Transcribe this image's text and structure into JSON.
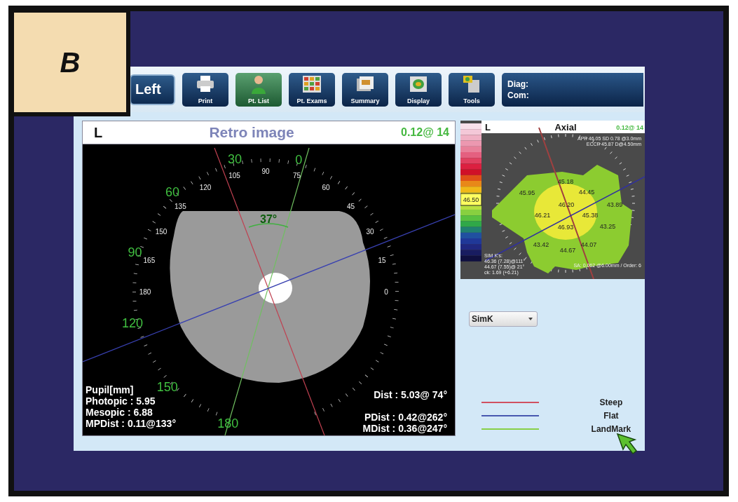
{
  "figure_label": "B",
  "toolbar": {
    "side_button": "Left",
    "buttons": [
      {
        "label": "Print",
        "kind": "print",
        "selected": false
      },
      {
        "label": "Pt. List",
        "kind": "patient",
        "selected": true
      },
      {
        "label": "Pt. Exams",
        "kind": "exams",
        "selected": false
      },
      {
        "label": "Summary",
        "kind": "summary",
        "selected": false
      },
      {
        "label": "Display",
        "kind": "display",
        "selected": false
      },
      {
        "label": "Tools",
        "kind": "tools",
        "selected": false
      }
    ],
    "diag_label": "Diag:",
    "com_label": "Com:"
  },
  "retro_panel": {
    "eye": "L",
    "title": "Retro image",
    "reading": "0.12@ 14",
    "angle": "37°",
    "landmark_scale": [
      "0",
      "30",
      "60",
      "90",
      "120",
      "150",
      "180"
    ],
    "axis_scale": [
      "0",
      "15",
      "30",
      "45",
      "60",
      "75",
      "90",
      "105",
      "120",
      "135",
      "150",
      "165",
      "180"
    ],
    "pupil_lines": [
      "Pupil[mm]",
      "Photopic : 5.95",
      "Mesopic : 6.88",
      "MPDist :  0.11@133°"
    ],
    "dist_lines": [
      "Dist :  5.03@ 74°",
      "PDist :  0.42@262°",
      "MDist :  0.36@247°"
    ]
  },
  "axial_panel": {
    "eye": "L",
    "title": "Axial",
    "reading": "0.12@ 14",
    "scale_highlight": "46.50",
    "info_lines": [
      "APP 46.05 SD 0.78 @3.0mm",
      "ECCP 45.87 D@4.50mm"
    ],
    "zone_values": [
      "45.18",
      "45.95",
      "44.45",
      "46.20",
      "43.89",
      "46.21",
      "45.38",
      "46.93",
      "43.25",
      "43.42",
      "44.67",
      "44.07"
    ],
    "simk_lines": [
      "SIM K's:",
      "46.36 (7.28)@111°",
      "44.67 (7.55)@ 21°",
      "ck: 1.69 (+6.21)"
    ],
    "sa_text": "SA: 0.062 @6.00mm / Order: 6"
  },
  "map_select": {
    "value": "SimK"
  },
  "legend": [
    {
      "label": "Steep",
      "color": "#d05060"
    },
    {
      "label": "Flat",
      "color": "#4858b0"
    },
    {
      "label": "LandMark",
      "color": "#88d048"
    }
  ]
}
